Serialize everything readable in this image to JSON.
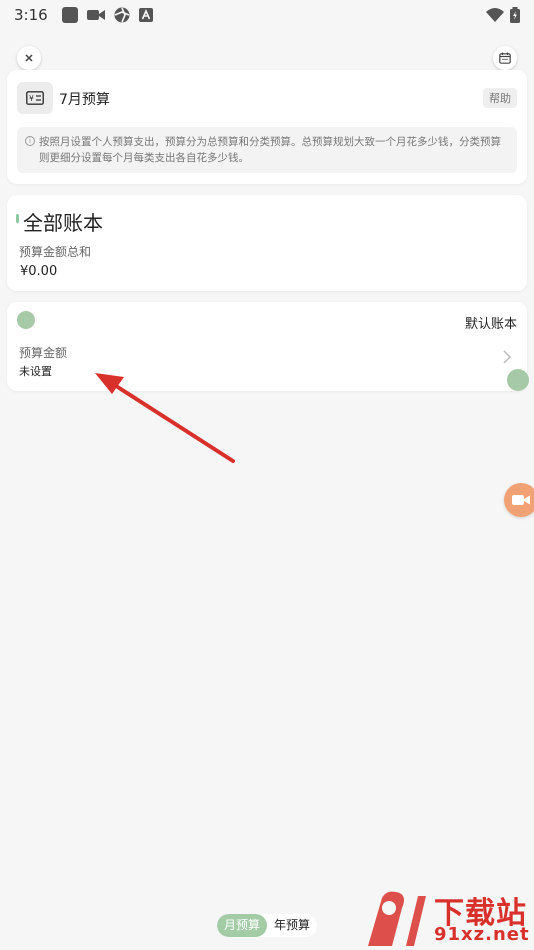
{
  "status_bar": {
    "time": "3:16"
  },
  "budget_card": {
    "title": "7月预算",
    "help_label": "帮助",
    "info_text": "按照月设置个人预算支出，预算分为总预算和分类预算。总预算规划大致一个月花多少钱，分类预算则更细分设置每个月每类支出各自花多少钱。"
  },
  "all_books_card": {
    "title": "全部账本",
    "subtitle": "预算金额总和",
    "amount": "¥0.00"
  },
  "default_book_card": {
    "name": "默认账本",
    "budget_label": "预算金额",
    "budget_value": "未设置"
  },
  "bottom_tabs": {
    "monthly": "月预算",
    "yearly": "年预算"
  },
  "watermark": {
    "brand": "下载站",
    "url": "91xz.net"
  },
  "colors": {
    "accent_green": "#a3cca6",
    "annotation_red": "#d8312c",
    "float_orange": "#f1a274"
  },
  "icons": {
    "close": "close-icon",
    "calendar": "calendar-icon",
    "budget": "money-card-icon",
    "info": "info-icon",
    "chevron": "chevron-right-icon",
    "float": "video-camera-icon"
  }
}
